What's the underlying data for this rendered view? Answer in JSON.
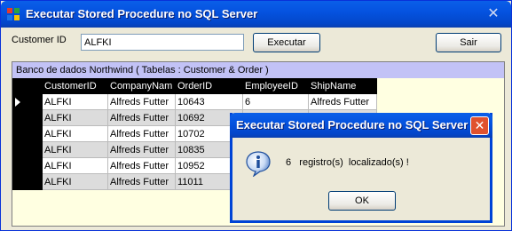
{
  "window": {
    "title": "Executar Stored Procedure no SQL Server",
    "close_glyph": "✕"
  },
  "form": {
    "customer_label": "Customer ID",
    "customer_value": "ALFKI",
    "execute_label": "Executar",
    "exit_label": "Sair"
  },
  "grid": {
    "caption": "Banco de dados Northwind ( Tabelas : Customer & Order )",
    "columns": [
      "CustomerID",
      "CompanyNam",
      "OrderID",
      "EmployeeID",
      "ShipName"
    ],
    "rows": [
      [
        "ALFKI",
        "Alfreds Futter",
        "10643",
        "6",
        "Alfreds Futter"
      ],
      [
        "ALFKI",
        "Alfreds Futter",
        "10692",
        "",
        ""
      ],
      [
        "ALFKI",
        "Alfreds Futter",
        "10702",
        "",
        ""
      ],
      [
        "ALFKI",
        "Alfreds Futter",
        "10835",
        "",
        ""
      ],
      [
        "ALFKI",
        "Alfreds Futter",
        "10952",
        "",
        ""
      ],
      [
        "ALFKI",
        "Alfreds Futter",
        "11011",
        "",
        ""
      ]
    ]
  },
  "dialog": {
    "title": "Executar Stored Procedure no SQL Server",
    "message": "6   registro(s)  localizado(s) !",
    "ok_label": "OK",
    "close_glyph": "✕",
    "icon": "info-icon"
  },
  "colors": {
    "titlebar": "#0553E0",
    "grid_caption": "#C2C2F6",
    "grid_background": "#FFFFE1"
  }
}
